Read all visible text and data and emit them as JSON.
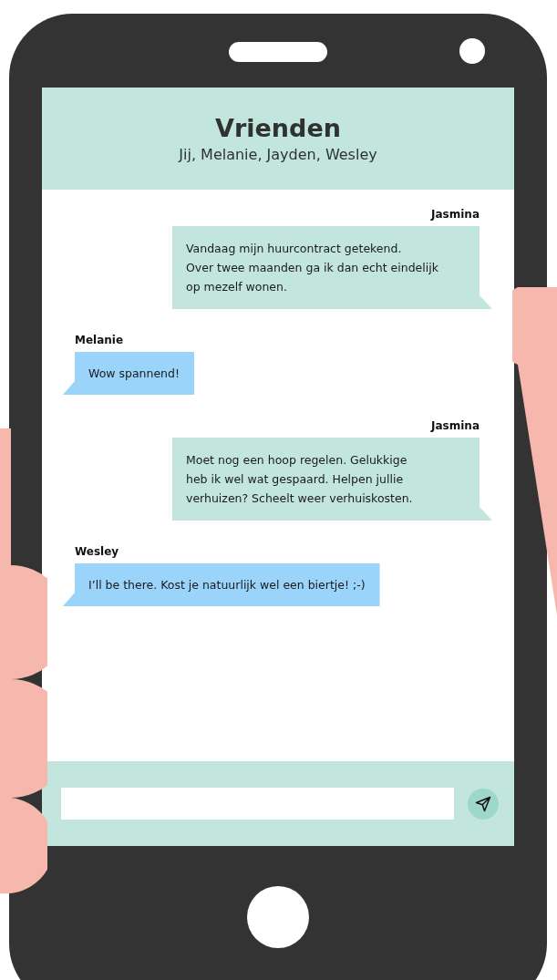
{
  "chat": {
    "title": "Vrienden",
    "members": "Jij, Melanie, Jayden, Wesley"
  },
  "messages": [
    {
      "kind": "sent",
      "author": "Jasmina",
      "text": "Vandaag mijn huurcontract getekend.\nOver twee maanden ga ik dan echt eindelijk\nop mezelf wonen."
    },
    {
      "kind": "received",
      "author": "Melanie",
      "text": "Wow spannend!"
    },
    {
      "kind": "sent",
      "author": "Jasmina",
      "text": "Moet nog een hoop regelen. Gelukkige\nheb ik wel wat gespaard. Helpen jullie\nverhuizen? Scheelt weer verhuiskosten."
    },
    {
      "kind": "received",
      "author": "Wesley",
      "text": "I’ll be there. Kost je natuurlijk wel een biertje! ;-)"
    }
  ]
}
